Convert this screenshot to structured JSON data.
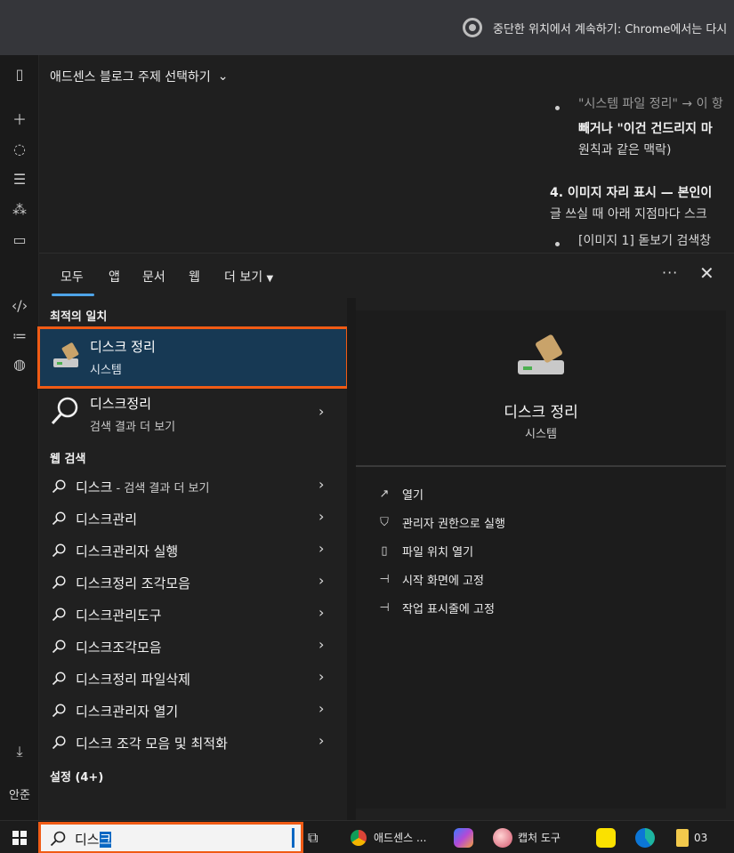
{
  "banner": {
    "text": "중단한 위치에서 계속하기: Chrome에서는 다시"
  },
  "conversation": {
    "title": "애드센스 블로그 주제 선택하기",
    "lines": [
      "\"시스템 파일 정리\" → 이 항",
      "빼거나 \"이건 건드리지 마",
      "원칙과 같은 맥락)",
      "4. 이미지 자리 표시 — 본인이",
      "글 쓰실 때 아래 지점마다 스크",
      "[이미지 1] 돋보기 검색창"
    ]
  },
  "rail": {
    "user_label": "안준"
  },
  "search_panel": {
    "tabs": [
      "모두",
      "앱",
      "문서",
      "웹",
      "더 보기"
    ],
    "active_tab": "모두",
    "best_match_title": "최적의 일치",
    "best_match": {
      "label": "디스크 정리",
      "sub": "시스템"
    },
    "second": {
      "label": "디스크정리",
      "sub": "검색 결과 더 보기"
    },
    "web_title": "웹 검색",
    "web_items": [
      {
        "label": "디스크",
        "suffix": " - 검색 결과 더 보기"
      },
      {
        "label": "디스크관리",
        "suffix": ""
      },
      {
        "label": "디스크관리자 실행",
        "suffix": ""
      },
      {
        "label": "디스크정리 조각모음",
        "suffix": ""
      },
      {
        "label": "디스크관리도구",
        "suffix": ""
      },
      {
        "label": "디스크조각모음",
        "suffix": ""
      },
      {
        "label": "디스크정리 파일삭제",
        "suffix": ""
      },
      {
        "label": "디스크관리자 열기",
        "suffix": ""
      },
      {
        "label": "디스크 조각 모음 및 최적화",
        "suffix": ""
      }
    ],
    "settings_title": "설정 (4+)",
    "preview": {
      "name": "디스크 정리",
      "sub": "시스템",
      "actions": [
        "열기",
        "관리자 권한으로 실행",
        "파일 위치 열기",
        "시작 화면에 고정",
        "작업 표시줄에 고정"
      ]
    }
  },
  "taskbar": {
    "search_text_plain": "디스",
    "search_text_selected": "크",
    "items": [
      {
        "label": "애드센스 ..."
      },
      {
        "label": "캡처 도구"
      },
      {
        "label": "03"
      }
    ]
  },
  "colors": {
    "highlight": "#f05b15",
    "selection": "#173954",
    "accent": "#4ea4e8"
  }
}
